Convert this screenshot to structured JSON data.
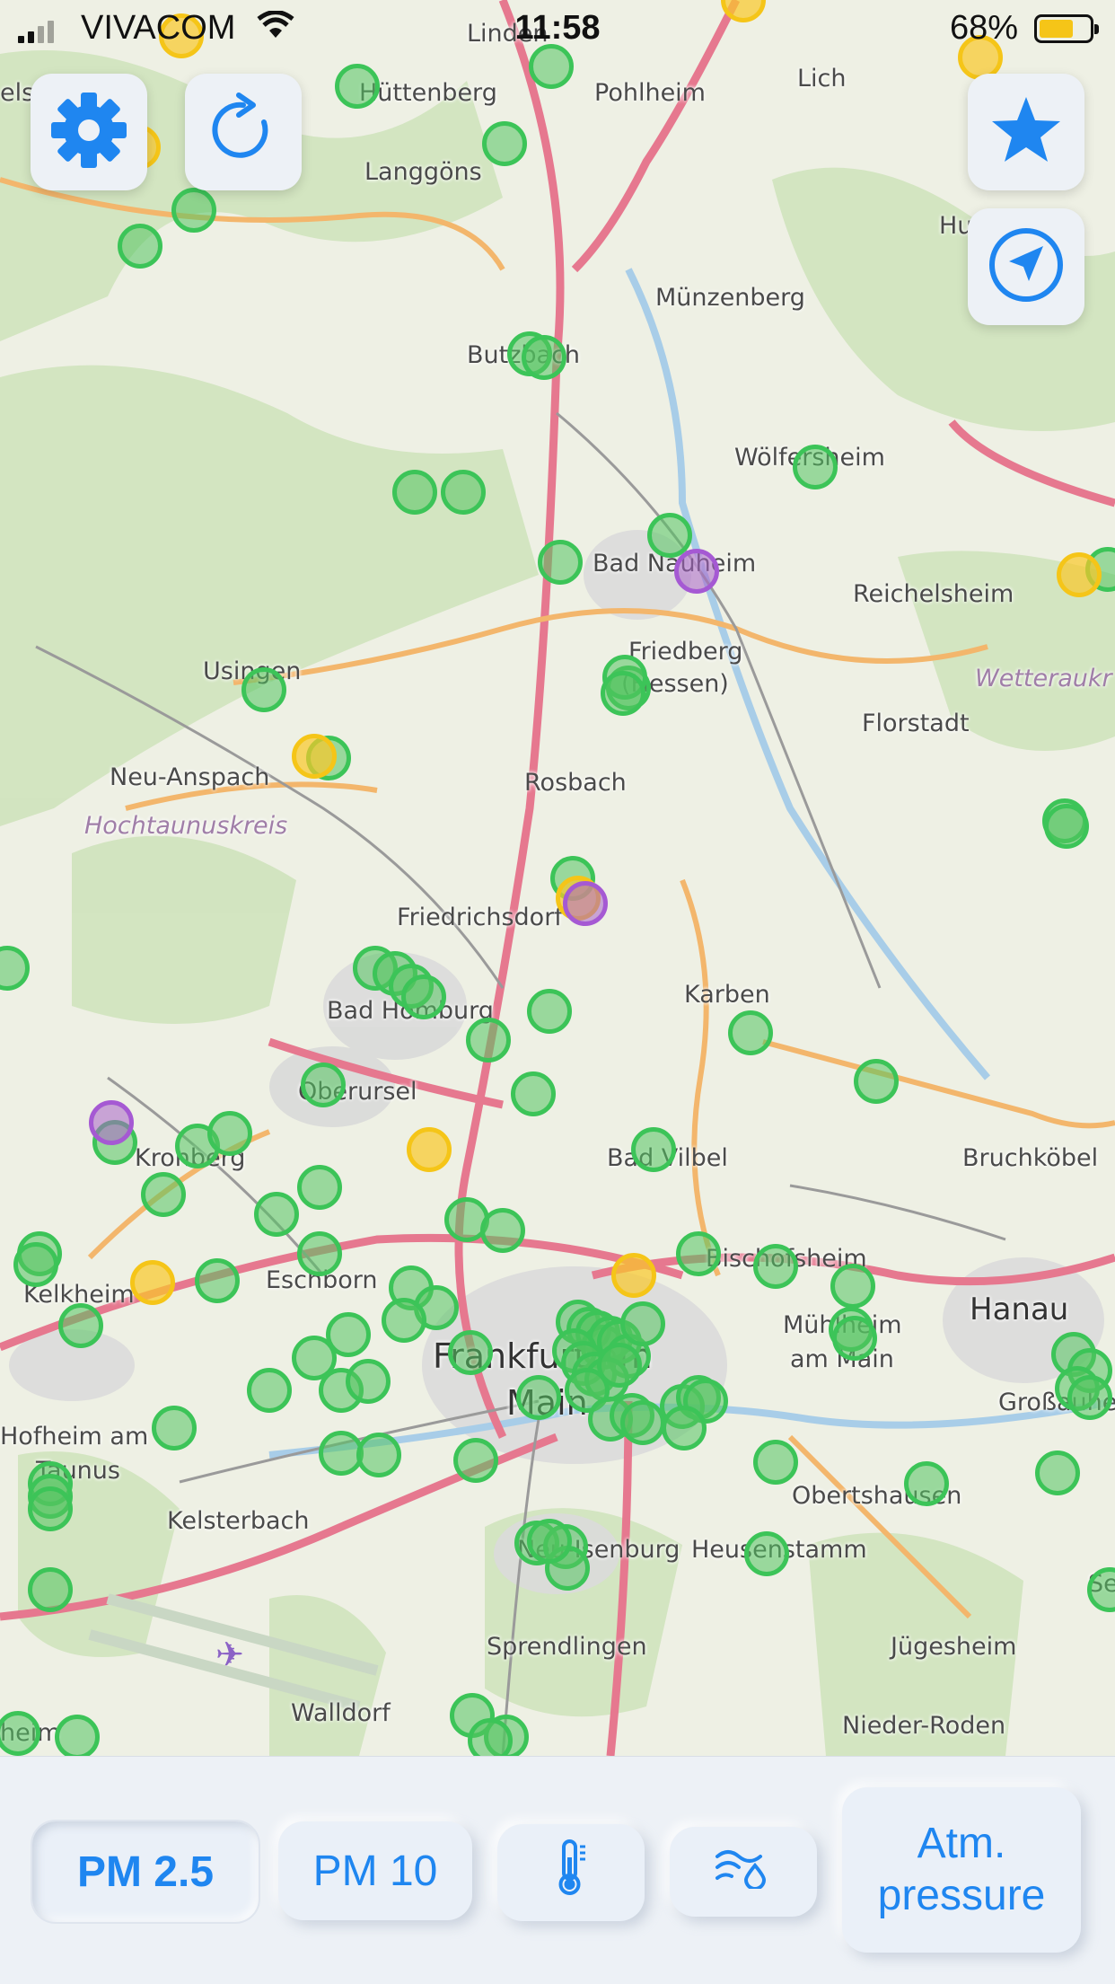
{
  "status_bar": {
    "carrier": "VIVACOM",
    "time": "11:58",
    "battery_percent": "68%",
    "battery_level": 0.68,
    "battery_color": "#f5c518"
  },
  "map": {
    "places": [
      {
        "name": "Linden",
        "cls": ""
      },
      {
        "name": "Hüttenberg",
        "cls": ""
      },
      {
        "name": "Pohlheim",
        "cls": ""
      },
      {
        "name": "Lich",
        "cls": ""
      },
      {
        "name": "Langgöns",
        "cls": ""
      },
      {
        "name": "Hu",
        "cls": ""
      },
      {
        "name": "Münzenberg",
        "cls": ""
      },
      {
        "name": "Butzbach",
        "cls": ""
      },
      {
        "name": "Wölfersheim",
        "cls": ""
      },
      {
        "name": "Bad Nauheim",
        "cls": ""
      },
      {
        "name": "Reichelsheim",
        "cls": ""
      },
      {
        "name": "Friedberg",
        "cls": ""
      },
      {
        "name": "(Hessen)",
        "cls": ""
      },
      {
        "name": "Usingen",
        "cls": ""
      },
      {
        "name": "Wetteraukr",
        "cls": "district"
      },
      {
        "name": "Florstadt",
        "cls": ""
      },
      {
        "name": "Neu-Anspach",
        "cls": ""
      },
      {
        "name": "Rosbach",
        "cls": ""
      },
      {
        "name": "Hochtaunuskreis",
        "cls": "district"
      },
      {
        "name": "Friedrichsdorf",
        "cls": ""
      },
      {
        "name": "Bad Homburg",
        "cls": ""
      },
      {
        "name": "Karben",
        "cls": ""
      },
      {
        "name": "Oberursel",
        "cls": ""
      },
      {
        "name": "Kronberg",
        "cls": ""
      },
      {
        "name": "Bad Vilbel",
        "cls": ""
      },
      {
        "name": "Bruchköbel",
        "cls": ""
      },
      {
        "name": "Kelkheim",
        "cls": ""
      },
      {
        "name": "Eschborn",
        "cls": ""
      },
      {
        "name": "Bischofsheim",
        "cls": ""
      },
      {
        "name": "Hanau",
        "cls": "big"
      },
      {
        "name": "Frankfurt am",
        "cls": "city"
      },
      {
        "name": "Main",
        "cls": "city"
      },
      {
        "name": "Mühlheim",
        "cls": ""
      },
      {
        "name": "am Main",
        "cls": ""
      },
      {
        "name": "Hofheim am",
        "cls": ""
      },
      {
        "name": "Taunus",
        "cls": ""
      },
      {
        "name": "Großauheim",
        "cls": ""
      },
      {
        "name": "Kelsterbach",
        "cls": ""
      },
      {
        "name": "Obertshausen",
        "cls": ""
      },
      {
        "name": "Neu-Isenburg",
        "cls": ""
      },
      {
        "name": "Heusenstamm",
        "cls": ""
      },
      {
        "name": "Sel",
        "cls": ""
      },
      {
        "name": "Sprendlingen",
        "cls": ""
      },
      {
        "name": "Jügesheim",
        "cls": ""
      },
      {
        "name": "Walldorf",
        "cls": ""
      },
      {
        "name": "Nieder-Roden",
        "cls": ""
      },
      {
        "name": "heim",
        "cls": ""
      },
      {
        "name": "els",
        "cls": ""
      }
    ],
    "sensor_counts": {
      "green": 108,
      "yellow": 10,
      "purple": 3
    },
    "colors": {
      "green": "#3cc458",
      "yellow": "#f5c518",
      "purple": "#a559d3"
    }
  },
  "buttons": {
    "settings": "gear-icon",
    "refresh": "refresh-icon",
    "favorites": "star-icon",
    "locate": "location-arrow-icon"
  },
  "tabs": [
    {
      "label": "PM 2.5",
      "active": true
    },
    {
      "label": "PM 10",
      "active": false
    },
    {
      "label": "",
      "icon": "thermometer-icon",
      "active": false
    },
    {
      "label": "",
      "icon": "humidity-icon",
      "active": false
    },
    {
      "label": "Atm. pressure",
      "active": false
    }
  ],
  "accent_color": "#1f86f0"
}
